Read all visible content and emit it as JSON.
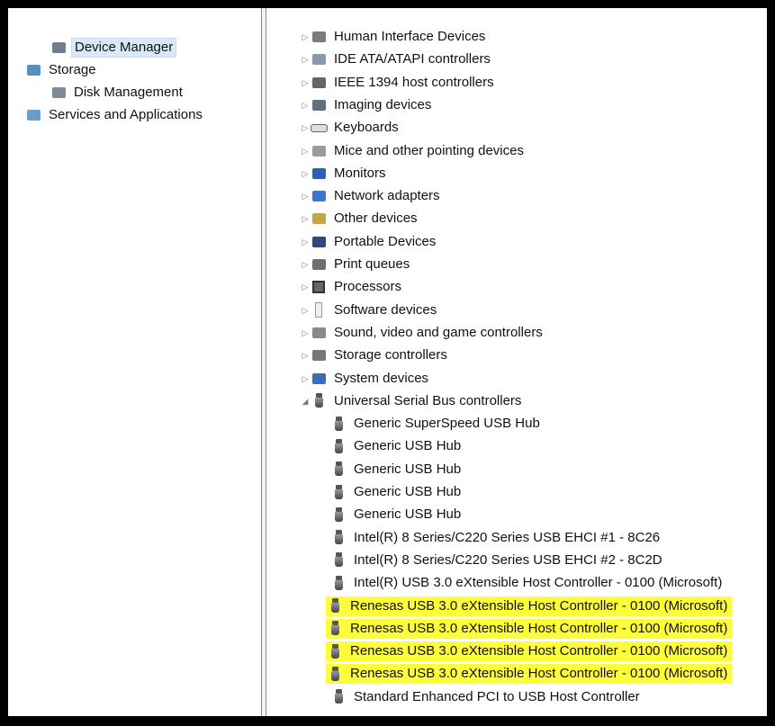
{
  "left_tree": [
    {
      "label": "Device Manager",
      "indent": 2,
      "expander": "",
      "icon": "device-manager-icon",
      "selected": true
    },
    {
      "label": "Storage",
      "indent": 0,
      "expander": "◢",
      "icon": "storage-icon",
      "selected": false
    },
    {
      "label": "Disk Management",
      "indent": 2,
      "expander": "",
      "icon": "disk-management-icon",
      "selected": false
    },
    {
      "label": "Services and Applications",
      "indent": 0,
      "expander": "▷",
      "icon": "services-icon",
      "selected": false
    }
  ],
  "device_categories": [
    {
      "label": "Human Interface Devices",
      "icon": "hid-icon"
    },
    {
      "label": "IDE ATA/ATAPI controllers",
      "icon": "ide-icon"
    },
    {
      "label": "IEEE 1394 host controllers",
      "icon": "ieee1394-icon"
    },
    {
      "label": "Imaging devices",
      "icon": "imaging-icon"
    },
    {
      "label": "Keyboards",
      "icon": "keyboard-icon"
    },
    {
      "label": "Mice and other pointing devices",
      "icon": "mouse-icon"
    },
    {
      "label": "Monitors",
      "icon": "monitor-icon"
    },
    {
      "label": "Network adapters",
      "icon": "network-icon"
    },
    {
      "label": "Other devices",
      "icon": "other-devices-icon"
    },
    {
      "label": "Portable Devices",
      "icon": "portable-icon"
    },
    {
      "label": "Print queues",
      "icon": "printer-icon"
    },
    {
      "label": "Processors",
      "icon": "processor-icon"
    },
    {
      "label": "Software devices",
      "icon": "software-icon"
    },
    {
      "label": "Sound, video and game controllers",
      "icon": "sound-icon"
    },
    {
      "label": "Storage controllers",
      "icon": "storage-controller-icon"
    },
    {
      "label": "System devices",
      "icon": "system-icon"
    }
  ],
  "usb_category": {
    "label": "Universal Serial Bus controllers",
    "icon": "usb-icon",
    "expander": "◢"
  },
  "usb_devices": [
    {
      "label": "Generic SuperSpeed USB Hub",
      "highlighted": false
    },
    {
      "label": "Generic USB Hub",
      "highlighted": false
    },
    {
      "label": "Generic USB Hub",
      "highlighted": false
    },
    {
      "label": "Generic USB Hub",
      "highlighted": false
    },
    {
      "label": "Generic USB Hub",
      "highlighted": false
    },
    {
      "label": "Intel(R) 8 Series/C220 Series USB EHCI #1 - 8C26",
      "highlighted": false
    },
    {
      "label": "Intel(R) 8 Series/C220 Series USB EHCI #2 - 8C2D",
      "highlighted": false
    },
    {
      "label": "Intel(R) USB 3.0 eXtensible Host Controller - 0100 (Microsoft)",
      "highlighted": false
    },
    {
      "label": "Renesas USB 3.0 eXtensible Host Controller - 0100 (Microsoft)",
      "highlighted": true
    },
    {
      "label": "Renesas USB 3.0 eXtensible Host Controller - 0100 (Microsoft)",
      "highlighted": true
    },
    {
      "label": "Renesas USB 3.0 eXtensible Host Controller - 0100 (Microsoft)",
      "highlighted": true
    },
    {
      "label": "Renesas USB 3.0 eXtensible Host Controller - 0100 (Microsoft)",
      "highlighted": true
    },
    {
      "label": "Standard Enhanced PCI to USB Host Controller",
      "highlighted": false
    }
  ],
  "colors": {
    "highlight": "#fdfd3a",
    "selection": "#dbe9f6",
    "frame": "#000000"
  }
}
